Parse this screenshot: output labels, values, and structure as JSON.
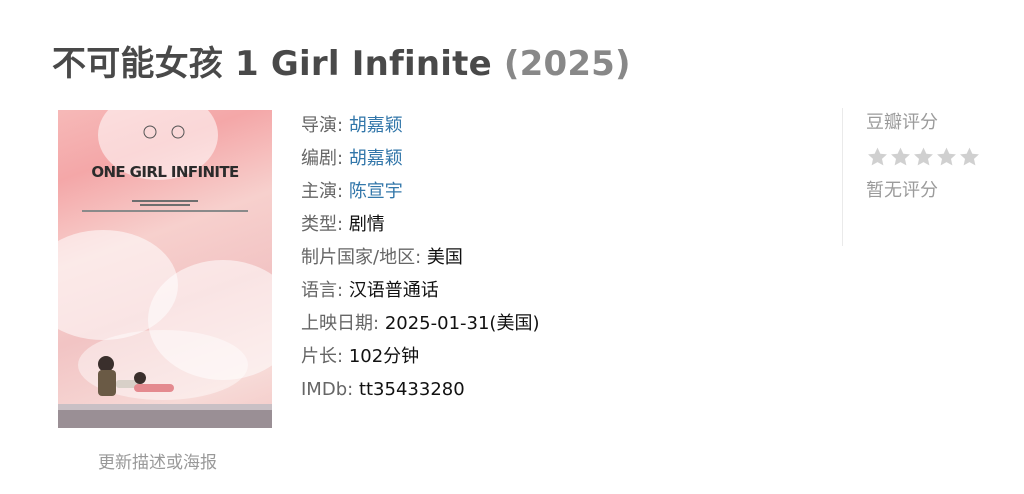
{
  "movie": {
    "title": "不可能女孩 1 Girl Infinite",
    "year": "(2025)",
    "update_link": "更新描述或海报",
    "poster": {
      "title_text": "ONE GIRL INFINITE",
      "colors": {
        "pink": "#f4a7a8",
        "ledge": "#9a8f95"
      }
    },
    "info": {
      "director_label": "导演:",
      "director_value": "胡嘉颖",
      "writer_label": "编剧:",
      "writer_value": "胡嘉颖",
      "cast_label": "主演:",
      "cast_value": "陈宣宇",
      "genre_label": "类型:",
      "genre_value": "剧情",
      "country_label": "制片国家/地区:",
      "country_value": "美国",
      "language_label": "语言:",
      "language_value": "汉语普通话",
      "release_label": "上映日期:",
      "release_value": "2025-01-31(美国)",
      "runtime_label": "片长:",
      "runtime_value": "102分钟",
      "imdb_label": "IMDb:",
      "imdb_value": "tt35433280"
    },
    "rating": {
      "heading": "豆瓣评分",
      "no_rating": "暂无评分",
      "stars_filled": 0,
      "stars_total": 5,
      "star_color": "#d0d0d0"
    },
    "colors": {
      "link": "#3377aa",
      "label": "#666666",
      "title": "#494949"
    }
  }
}
